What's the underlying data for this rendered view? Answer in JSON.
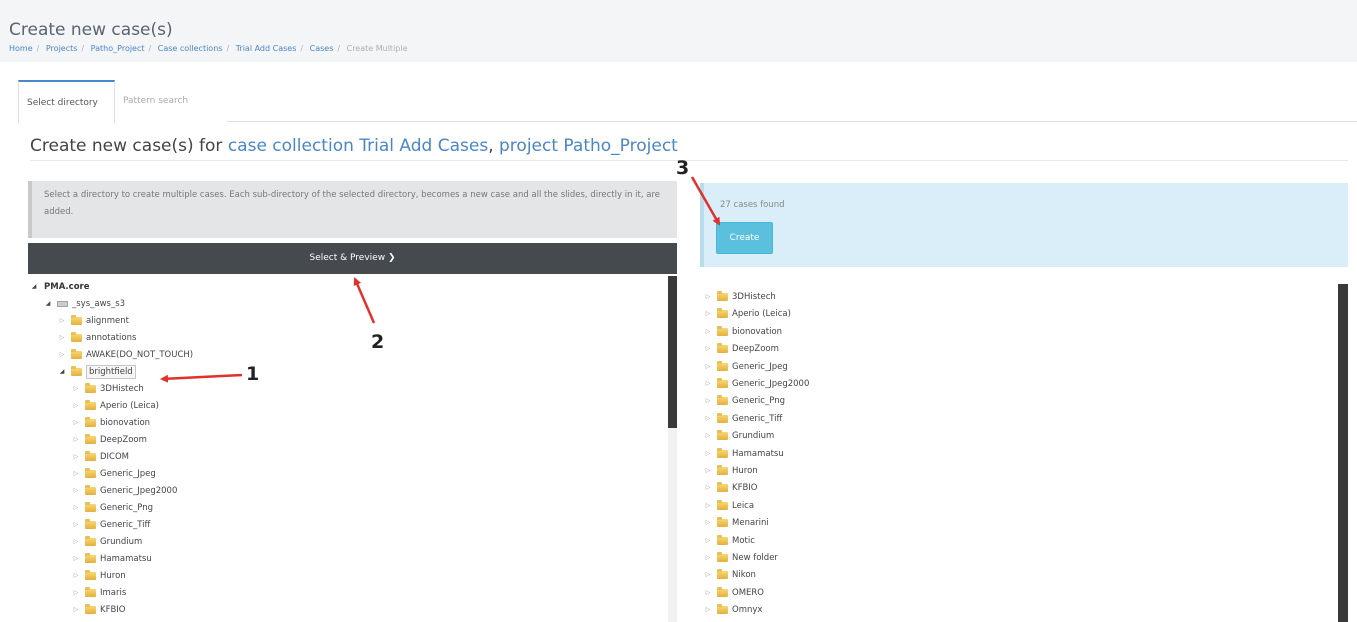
{
  "header": {
    "title": "Create new case(s)",
    "breadcrumb": [
      "Home",
      "Projects",
      "Patho_Project",
      "Case collections",
      "Trial Add Cases",
      "Cases",
      "Create Multiple"
    ]
  },
  "tabs": [
    {
      "label": "Select directory",
      "active": true
    },
    {
      "label": "Pattern search",
      "active": false
    }
  ],
  "heading": {
    "prefix": "Create new case(s) for ",
    "collection_link": "case collection Trial Add Cases",
    "separator": ", ",
    "project_link": "project Patho_Project"
  },
  "info_text": "Select a directory to create multiple cases. Each sub-directory of the selected directory, becomes a new case and all the slides, directly in it, are added.",
  "preview_button": {
    "label": "Select & Preview",
    "icon": "chevron-right-icon"
  },
  "left_tree": {
    "root": "PMA.core",
    "drive": "_sys_aws_s3",
    "top_folders": [
      "alignment",
      "annotations",
      "AWAKE(DO_NOT_TOUCH)"
    ],
    "selected": "brightfield",
    "children": [
      "3DHistech",
      "Aperio (Leica)",
      "bionovation",
      "DeepZoom",
      "DICOM",
      "Generic_Jpeg",
      "Generic_Jpeg2000",
      "Generic_Png",
      "Generic_Tiff",
      "Grundium",
      "Hamamatsu",
      "Huron",
      "Imaris",
      "KFBIO"
    ]
  },
  "result": {
    "found_text": "27 cases found",
    "create_label": "Create",
    "folders": [
      "3DHistech",
      "Aperio (Leica)",
      "bionovation",
      "DeepZoom",
      "Generic_Jpeg",
      "Generic_Jpeg2000",
      "Generic_Png",
      "Generic_Tiff",
      "Grundium",
      "Hamamatsu",
      "Huron",
      "KFBIO",
      "Leica",
      "Menarini",
      "Motic",
      "New folder",
      "Nikon",
      "OMERO",
      "Omnyx"
    ]
  },
  "annotations": [
    "1",
    "2",
    "3"
  ],
  "colors": {
    "link": "#4a86c5",
    "create_button": "#5bc0de",
    "arrow": "#e0312b",
    "dark_bar": "#454a4f"
  }
}
